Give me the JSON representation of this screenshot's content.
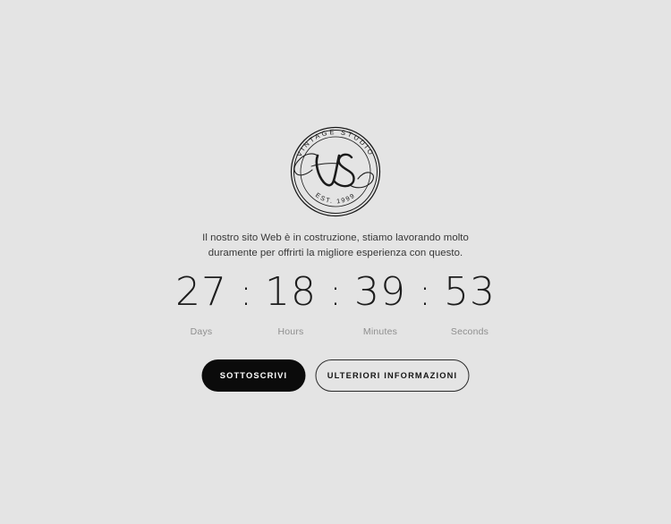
{
  "page": {
    "background_color": "#e4e4e4",
    "text_color": "#363636"
  },
  "logo": {
    "name": "vintage-studio-badge",
    "monogram": "VS",
    "arc_top_text": "VINTAGE STUDIO",
    "arc_bottom_text": "EST. 1999",
    "color": "#1a1a1a"
  },
  "intro": {
    "line1": "Il nostro sito Web è in costruzione, stiamo lavorando molto",
    "line2": "duramente per offrirti la migliore esperienza con questo."
  },
  "countdown": {
    "separator": ":",
    "units": [
      {
        "value": "27",
        "label": "Days"
      },
      {
        "value": "18",
        "label": "Hours"
      },
      {
        "value": "39",
        "label": "Minutes"
      },
      {
        "value": "53",
        "label": "Seconds"
      }
    ],
    "value_color": "#1d1d1d",
    "label_color": "#8e8e8e"
  },
  "buttons": {
    "primary_label": "SOTTOSCRIVI",
    "secondary_label": "ULTERIORI INFORMAZIONI",
    "primary_bg": "#0b0b0b",
    "primary_fg": "#ffffff",
    "secondary_border": "#2a2a2a"
  }
}
